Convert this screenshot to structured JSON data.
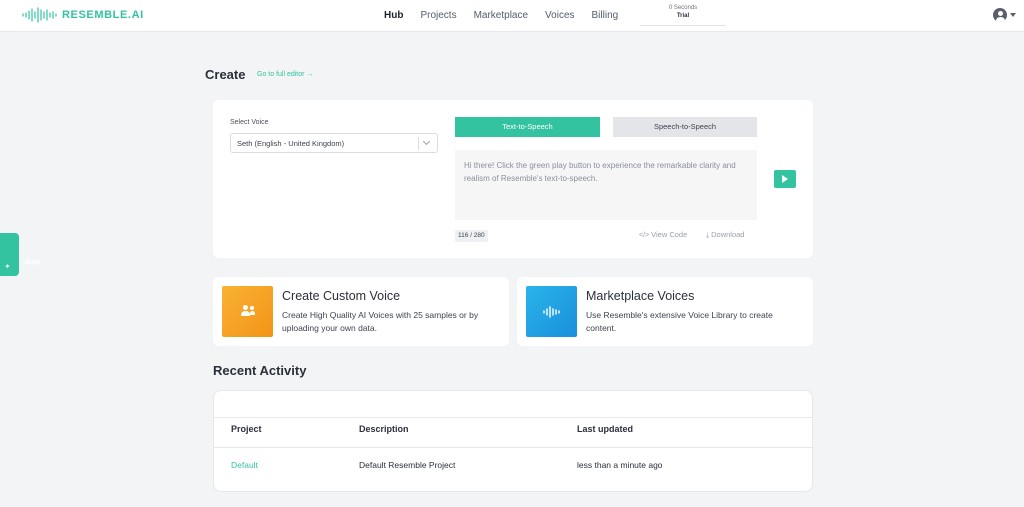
{
  "brand": {
    "name": "RESEMBLE.AI",
    "accent": "#34c3a0"
  },
  "nav": {
    "items": [
      "Hub",
      "Projects",
      "Marketplace",
      "Voices",
      "Billing"
    ],
    "active": "Hub"
  },
  "usage": {
    "seconds": "0 Seconds",
    "plan": "Trial"
  },
  "account": {
    "icon": "user-circle-icon"
  },
  "help": {
    "label": "Help"
  },
  "create": {
    "title": "Create",
    "full_editor_link": "Go to full editor →",
    "select_voice_label": "Select Voice",
    "selected_voice": "Seth (English - United Kingdom)",
    "tabs": [
      "Text-to-Speech",
      "Speech-to-Speech"
    ],
    "active_tab": "Text-to-Speech",
    "text_value": "Hi there! Click the green play button to experience the remarkable clarity and realism of Resemble's text-to-speech.",
    "char_count": "116 / 280",
    "view_code": "View Code",
    "download": "Download"
  },
  "features": [
    {
      "title": "Create Custom Voice",
      "desc": "Create High Quality AI Voices with 25 samples or by uploading your own data.",
      "icon": "users-icon",
      "color": "#f7a325"
    },
    {
      "title": "Marketplace Voices",
      "desc": "Use Resemble's extensive Voice Library to create content.",
      "icon": "waveform-icon",
      "color": "#21a3e3"
    }
  ],
  "recent": {
    "title": "Recent Activity",
    "columns": [
      "Project",
      "Description",
      "Last updated"
    ],
    "rows": [
      {
        "project": "Default",
        "description": "Default Resemble Project",
        "updated": "less than a minute ago"
      }
    ]
  }
}
